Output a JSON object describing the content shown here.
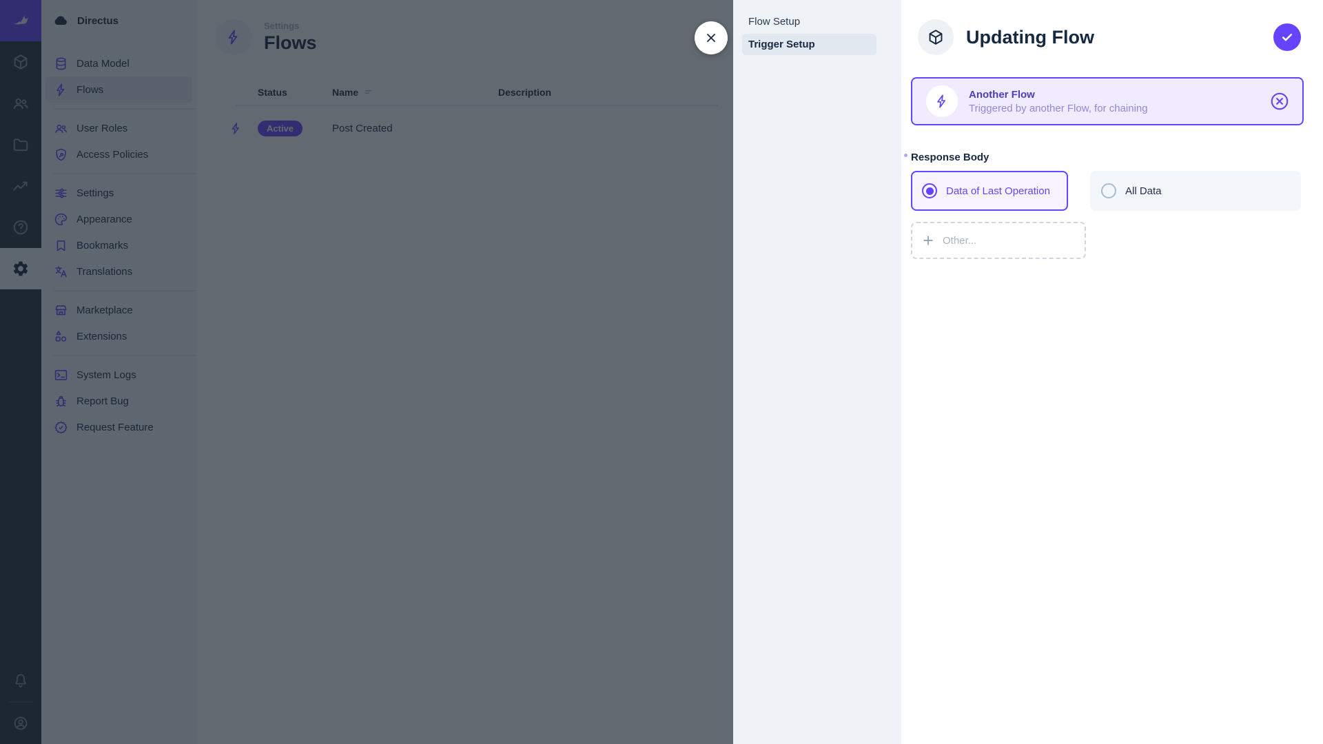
{
  "colors": {
    "accent": "#6644ff",
    "accent_soft_bg": "#f0ebff",
    "nav_bg": "#f0f4f9",
    "rail_bg": "#263238",
    "text_dark": "#172940",
    "overlay": "rgba(25,34,45,0.68)"
  },
  "module_bar": {
    "logo_icon": "directus-rabbit-logo",
    "modules": [
      {
        "icon": "content-cube-icon",
        "active": false
      },
      {
        "icon": "users-icon",
        "active": false
      },
      {
        "icon": "files-folder-icon",
        "active": false
      },
      {
        "icon": "insights-chart-icon",
        "active": false
      },
      {
        "icon": "help-icon",
        "active": false
      },
      {
        "icon": "settings-gear-icon",
        "active": true
      }
    ],
    "bottom": [
      {
        "icon": "notifications-bell-icon"
      },
      {
        "icon": "account-circle-icon"
      }
    ]
  },
  "sidebar": {
    "project_name": "Directus",
    "project_icon": "cloud-icon",
    "sections": [
      {
        "items": [
          {
            "label": "Data Model",
            "icon": "database-icon",
            "active": false
          },
          {
            "label": "Flows",
            "icon": "bolt-icon",
            "active": true
          }
        ]
      },
      {
        "items": [
          {
            "label": "User Roles",
            "icon": "people-icon",
            "active": false
          },
          {
            "label": "Access Policies",
            "icon": "shield-key-icon",
            "active": false
          }
        ]
      },
      {
        "items": [
          {
            "label": "Settings",
            "icon": "tune-sliders-icon",
            "active": false
          },
          {
            "label": "Appearance",
            "icon": "palette-icon",
            "active": false
          },
          {
            "label": "Bookmarks",
            "icon": "bookmark-icon",
            "active": false
          },
          {
            "label": "Translations",
            "icon": "translate-icon",
            "active": false
          }
        ]
      },
      {
        "items": [
          {
            "label": "Marketplace",
            "icon": "storefront-icon",
            "active": false
          },
          {
            "label": "Extensions",
            "icon": "extension-shapes-icon",
            "active": false
          }
        ]
      },
      {
        "items": [
          {
            "label": "System Logs",
            "icon": "terminal-icon",
            "active": false
          },
          {
            "label": "Report Bug",
            "icon": "bug-icon",
            "active": false
          },
          {
            "label": "Request Feature",
            "icon": "verified-badge-icon",
            "active": false
          }
        ]
      }
    ]
  },
  "main": {
    "breadcrumb": "Settings",
    "title": "Flows",
    "header_icon": "bolt-icon",
    "table": {
      "columns": [
        "Status",
        "Name",
        "Description"
      ],
      "rows": [
        {
          "status": "Active",
          "name": "Post Created",
          "description": ""
        }
      ]
    }
  },
  "drawer": {
    "nav": [
      {
        "label": "Flow Setup",
        "active": false
      },
      {
        "label": "Trigger Setup",
        "active": true
      }
    ],
    "title": "Updating Flow",
    "header_icon": "cube-icon",
    "trigger_card": {
      "icon": "bolt-icon",
      "title": "Another Flow",
      "subtitle": "Triggered by another Flow, for chaining"
    },
    "response_body": {
      "label": "Response Body",
      "required": true,
      "options": [
        {
          "label": "Data of Last Operation",
          "selected": true
        },
        {
          "label": "All Data",
          "selected": false
        }
      ],
      "other_label": "Other..."
    }
  }
}
